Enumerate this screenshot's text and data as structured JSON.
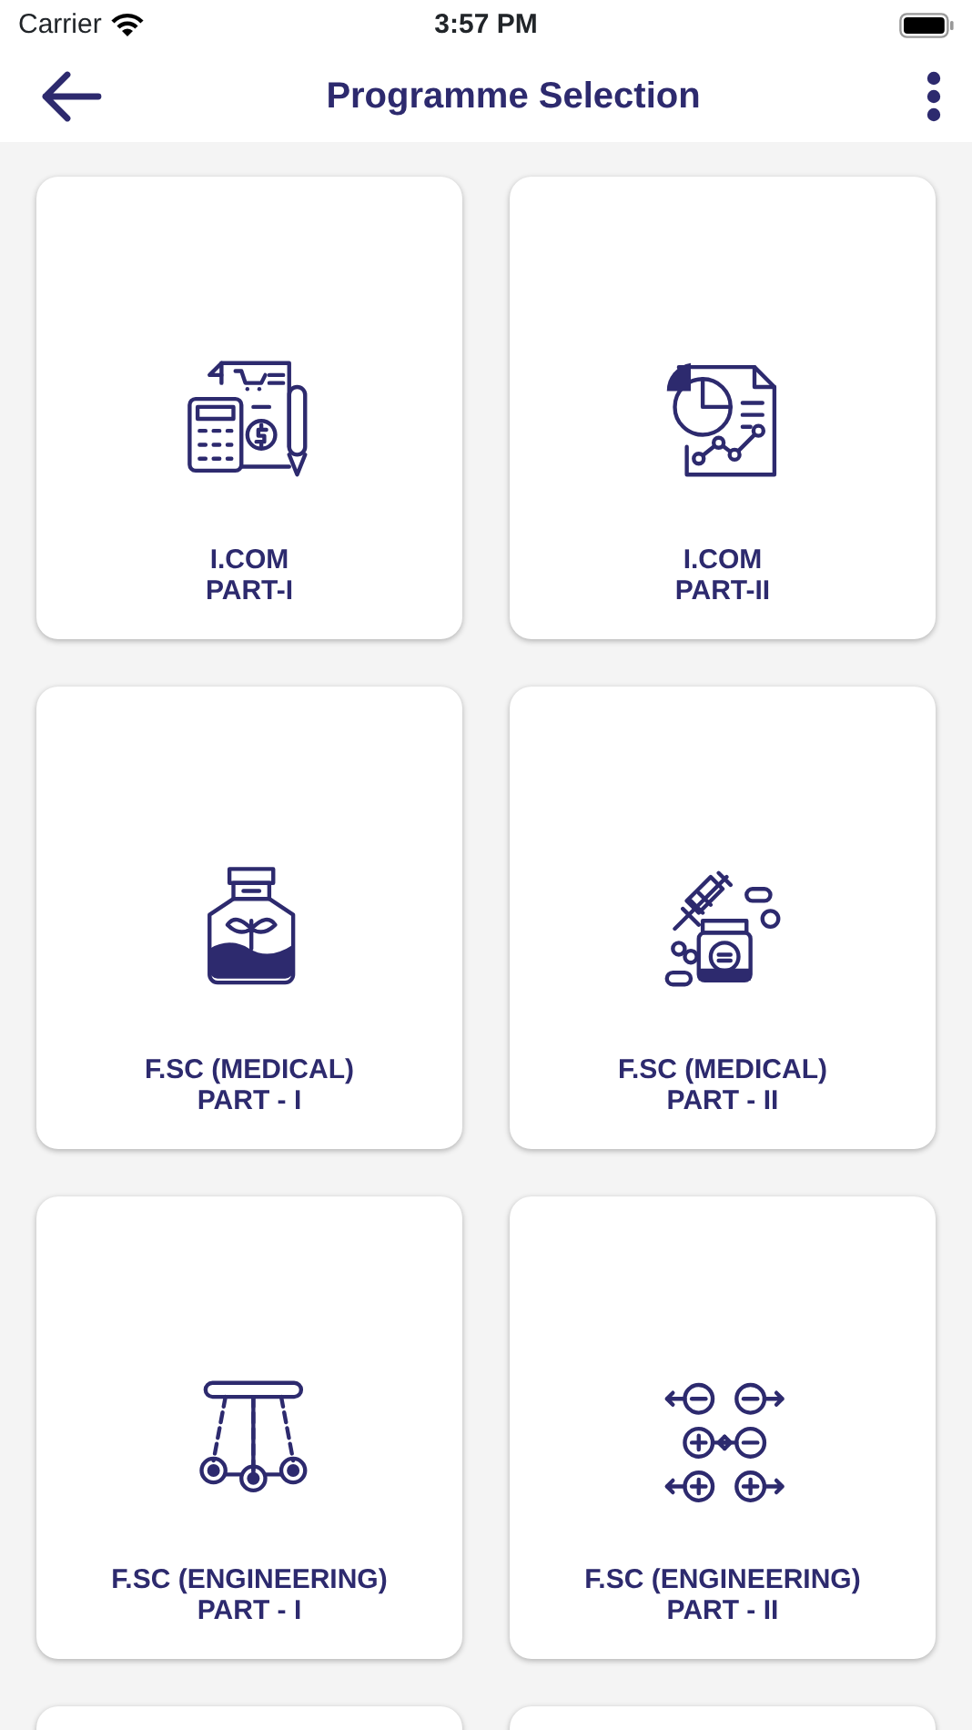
{
  "status_bar": {
    "carrier": "Carrier",
    "time": "3:57 PM"
  },
  "header": {
    "title": "Programme Selection"
  },
  "programmes": [
    {
      "kind": "card",
      "lines": [
        "I.COM",
        "PART-I"
      ]
    },
    {
      "kind": "card",
      "lines": [
        "I.COM",
        "PART-II"
      ]
    },
    {
      "kind": "card",
      "lines": [
        "F.SC (MEDICAL)",
        "PART - I"
      ]
    },
    {
      "kind": "card",
      "lines": [
        "F.SC (MEDICAL)",
        "PART - II"
      ]
    },
    {
      "kind": "card",
      "lines": [
        "F.SC (ENGINEERING)",
        "PART - I"
      ]
    },
    {
      "kind": "card",
      "lines": [
        "F.SC (ENGINEERING)",
        "PART - II"
      ]
    },
    {
      "kind": "cut-off"
    },
    {
      "kind": "cut-off"
    }
  ]
}
